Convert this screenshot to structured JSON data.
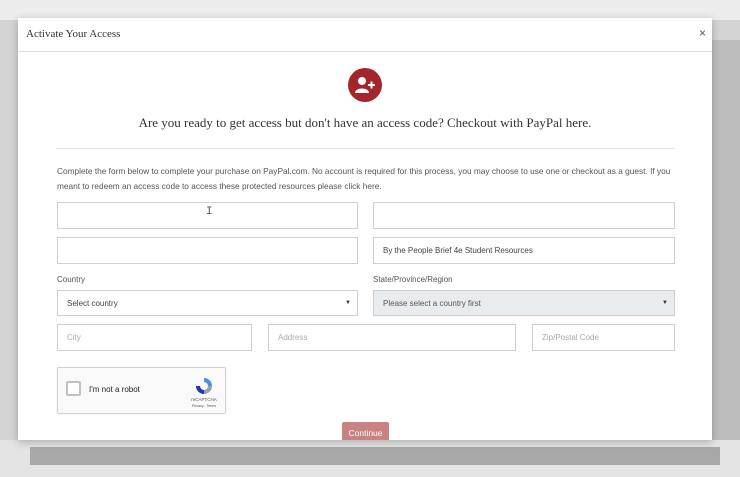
{
  "modal": {
    "title": "Activate Your Access",
    "close": "×"
  },
  "hero": {
    "icon": "user-plus-icon",
    "headline": "Are you ready to get access but don't have an access code? Checkout with PayPal here."
  },
  "instructions": "Complete the form below to complete your purchase on PayPal.com. No account is required for this process, you may choose to use one or checkout as a guest. If you meant to redeem an access code to access these protected resources please click here.",
  "form": {
    "product_value": "By the People Brief 4e Student Resources",
    "country_label": "Country",
    "country_selected": "Select country",
    "state_label": "State/Province/Region",
    "state_selected": "Please select a country first",
    "city_placeholder": "City",
    "address_placeholder": "Address",
    "zip_placeholder": "Zip/Postal Code",
    "cursor": "I"
  },
  "captcha": {
    "label": "I'm not a robot",
    "brand": "reCAPTCHA",
    "links": "Privacy - Terms"
  },
  "continue_label": "Continue",
  "colors": {
    "brand": "#a3262c",
    "button": "#c98182"
  }
}
